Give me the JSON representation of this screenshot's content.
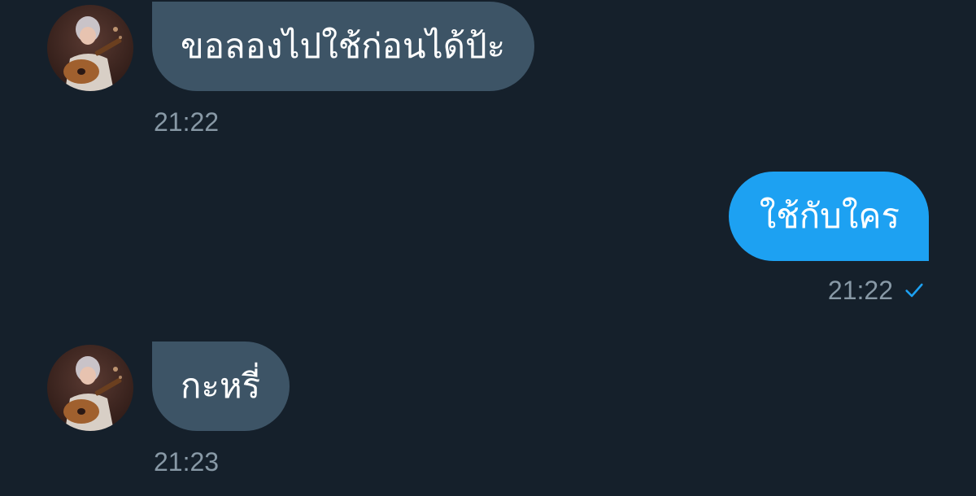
{
  "colors": {
    "background": "#15202b",
    "incoming_bubble": "#3d5466",
    "outgoing_bubble": "#1da1f2",
    "timestamp": "#8899a6",
    "read_check": "#1da1f2"
  },
  "messages": [
    {
      "direction": "incoming",
      "text": "ขอลองไปใช้ก่อนได้ป้ะ",
      "time": "21:22",
      "avatar_icon": "user-avatar-guitar"
    },
    {
      "direction": "outgoing",
      "text": "ใช้กับใคร",
      "time": "21:22",
      "status_icon": "checkmark-icon"
    },
    {
      "direction": "incoming",
      "text": "กะหรี่",
      "time": "21:23",
      "avatar_icon": "user-avatar-guitar"
    }
  ]
}
